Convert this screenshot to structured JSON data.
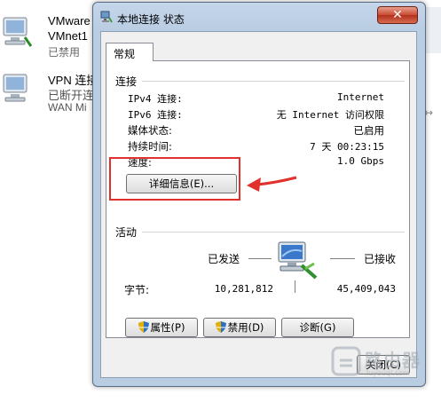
{
  "background": {
    "items": [
      {
        "line1": "VMware",
        "line2": "VMnet1",
        "line3": "已禁用"
      },
      {
        "line1": "VPN 连接",
        "line2": "已断开连接",
        "line3": "WAN Mi"
      }
    ],
    "edge_mark": "↔"
  },
  "dialog": {
    "title": "本地连接 状态",
    "close_label": "✕",
    "tab": "常规",
    "connection": {
      "group_title": "连接",
      "rows": [
        {
          "label": "IPv4 连接:",
          "value": "Internet"
        },
        {
          "label": "IPv6 连接:",
          "value": "无 Internet 访问权限"
        },
        {
          "label": "媒体状态:",
          "value": "已启用"
        },
        {
          "label": "持续时间:",
          "value": "7 天 00:23:15"
        },
        {
          "label": "速度:",
          "value": "1.0 Gbps"
        }
      ],
      "details_button": "详细信息(E)..."
    },
    "activity": {
      "group_title": "活动",
      "sent_label": "已发送",
      "received_label": "已接收",
      "bytes_label": "字节:",
      "bytes_sent": "10,281,812",
      "bytes_received": "45,409,043"
    },
    "buttons": {
      "properties": "属性(P)",
      "disable": "禁用(D)",
      "diagnose": "诊断(G)",
      "close": "关闭(C)"
    }
  },
  "watermark": {
    "text": "路由器",
    "sub": "luyouqi.com"
  },
  "colors": {
    "annotation": "#e0312c",
    "title_bar": "#c5d6ea",
    "close_button": "#c94a33"
  }
}
